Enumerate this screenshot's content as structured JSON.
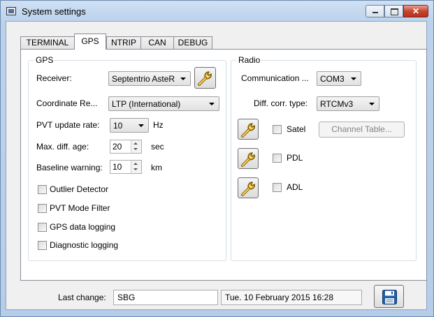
{
  "window": {
    "title": "System settings"
  },
  "tabs": [
    {
      "label": "TERMINAL"
    },
    {
      "label": "GPS"
    },
    {
      "label": "NTRIP"
    },
    {
      "label": "CAN"
    },
    {
      "label": "DEBUG"
    }
  ],
  "active_tab": "GPS",
  "gps": {
    "group_label": "GPS",
    "receiver_label": "Receiver:",
    "receiver_value": "Septentrio AsteR",
    "coordinate_label": "Coordinate Re...",
    "coordinate_value": "LTP (International)",
    "pvt_rate_label": "PVT update rate:",
    "pvt_rate_value": "10",
    "pvt_rate_unit": "Hz",
    "max_diff_label": "Max. diff. age:",
    "max_diff_value": "20",
    "max_diff_unit": "sec",
    "baseline_label": "Baseline warning:",
    "baseline_value": "10",
    "baseline_unit": "km",
    "checks": [
      {
        "label": "Outlier Detector",
        "checked": false
      },
      {
        "label": "PVT Mode Filter",
        "checked": false
      },
      {
        "label": "GPS data logging",
        "checked": false
      },
      {
        "label": "Diagnostic logging",
        "checked": false
      }
    ]
  },
  "radio": {
    "group_label": "Radio",
    "communication_label": "Communication ...",
    "communication_value": "COM3",
    "diff_corr_label": "Diff. corr. type:",
    "diff_corr_value": "RTCMv3",
    "satel_label": "Satel",
    "pdl_label": "PDL",
    "adl_label": "ADL",
    "channel_table_label": "Channel Table..."
  },
  "footer": {
    "last_change_label": "Last change:",
    "last_change_user": "SBG",
    "last_change_date": "Tue. 10 February 2015 16:28"
  },
  "icons": {
    "wrench": "wrench-icon",
    "save": "floppy-disk-icon"
  }
}
